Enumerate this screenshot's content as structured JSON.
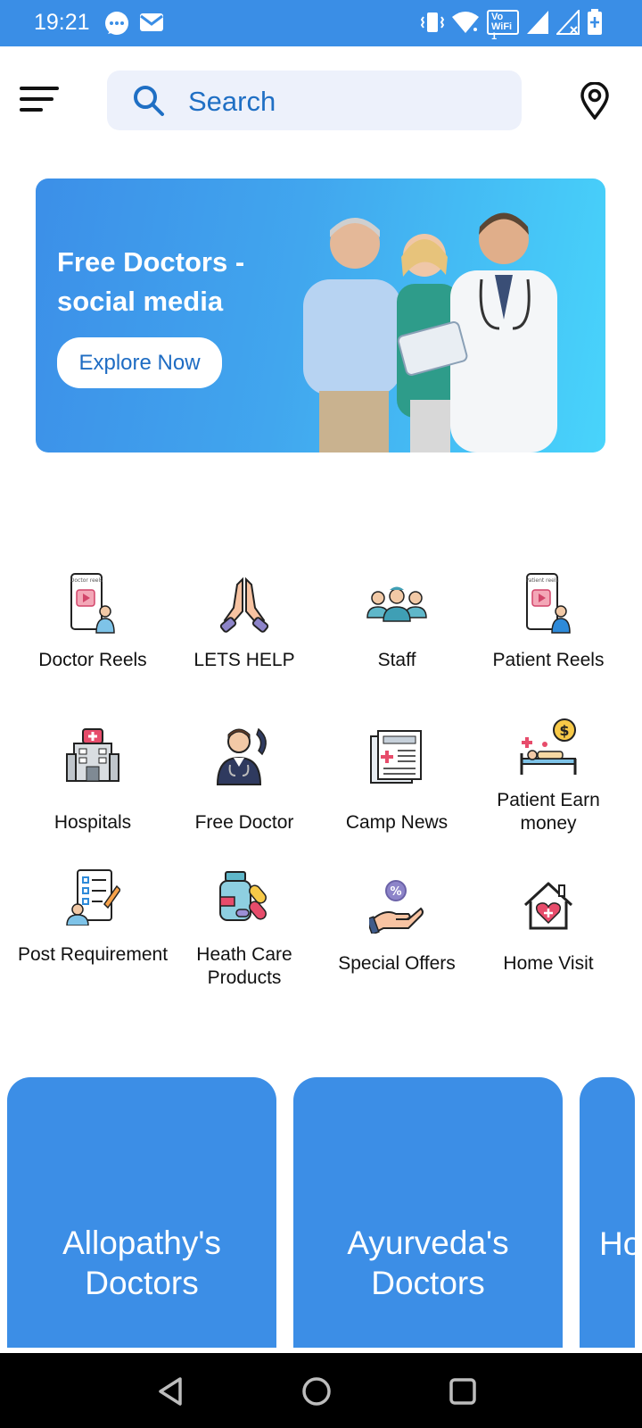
{
  "status_bar": {
    "time": "19:21",
    "wifi_label": "Vo WiFi 1",
    "background": "#3a8ee6"
  },
  "header": {
    "menu_icon": "menu-icon",
    "search_placeholder": "Search",
    "location_icon": "location-pin-icon"
  },
  "banner": {
    "title": "Free Doctors - social media",
    "button_label": "Explore Now"
  },
  "categories": [
    {
      "label": "Doctor Reels",
      "icon": "doctor-reels-icon",
      "screen_text": "Doctor reels"
    },
    {
      "label": "LETS HELP",
      "icon": "praying-hands-icon"
    },
    {
      "label": "Staff",
      "icon": "staff-icon"
    },
    {
      "label": "Patient Reels",
      "icon": "patient-reels-icon",
      "screen_text": "Patient reels"
    },
    {
      "label": "Hospitals",
      "icon": "hospital-icon"
    },
    {
      "label": "Free Doctor",
      "icon": "doctor-phone-icon"
    },
    {
      "label": "Camp News",
      "icon": "newspaper-icon"
    },
    {
      "label": "Patient Earn money",
      "icon": "patient-bed-money-icon"
    },
    {
      "label": "Post Requirement",
      "icon": "checklist-icon"
    },
    {
      "label": "Heath Care Products",
      "icon": "medicine-bottle-icon"
    },
    {
      "label": "Special Offers",
      "icon": "discount-hand-icon"
    },
    {
      "label": "Home Visit",
      "icon": "home-heart-icon"
    }
  ],
  "doctor_cards": [
    {
      "label": "Allopathy's\nDoctors"
    },
    {
      "label": "Ayurveda's\nDoctors"
    },
    {
      "label": "Ho"
    }
  ],
  "colors": {
    "accent": "#3c8ee6",
    "search_bg": "#edf1fb",
    "search_text": "#1f6fc4"
  }
}
